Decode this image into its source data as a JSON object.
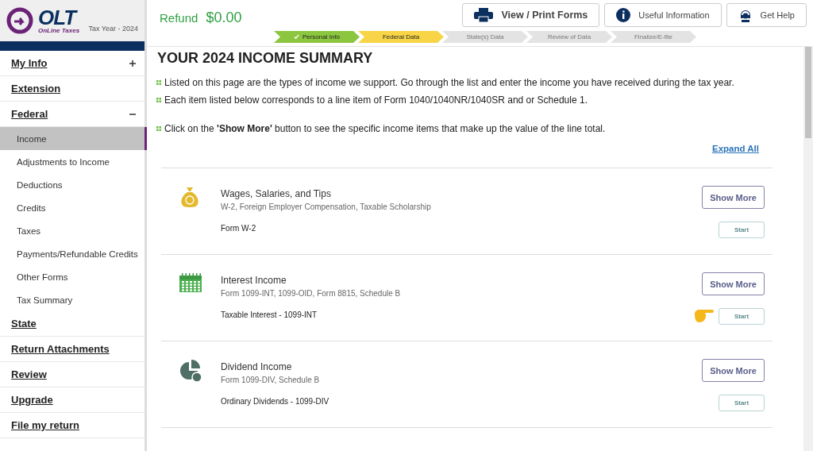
{
  "brand": {
    "name": "OLT",
    "tagline": "OnLine Taxes",
    "tax_year": "Tax Year - 2024"
  },
  "sidebar": {
    "items": [
      {
        "label": "My Info",
        "expanded": false
      },
      {
        "label": "Extension"
      },
      {
        "label": "Federal",
        "expanded": true,
        "children": [
          {
            "label": "Income",
            "selected": true
          },
          {
            "label": "Adjustments to Income",
            "selected": false
          },
          {
            "label": "Deductions",
            "selected": false
          },
          {
            "label": "Credits",
            "selected": false
          },
          {
            "label": "Taxes",
            "selected": false
          },
          {
            "label": "Payments/Refundable Credits",
            "selected": false
          },
          {
            "label": "Other Forms",
            "selected": false
          },
          {
            "label": "Tax Summary",
            "selected": false
          }
        ]
      },
      {
        "label": "State"
      },
      {
        "label": "Return Attachments"
      },
      {
        "label": "Review"
      },
      {
        "label": "Upgrade"
      },
      {
        "label": "File my return"
      }
    ]
  },
  "refund": {
    "label": "Refund",
    "amount": "$0.00"
  },
  "header_buttons": [
    {
      "kind": "print",
      "label": "View / Print Forms"
    },
    {
      "kind": "info",
      "label": "Useful Information"
    },
    {
      "kind": "help",
      "label": "Get Help"
    }
  ],
  "steps": [
    {
      "label": "Personal Info",
      "completed": true,
      "current": false
    },
    {
      "label": "Federal Data",
      "completed": false,
      "current": true
    },
    {
      "label": "State(s) Data",
      "completed": false,
      "current": false
    },
    {
      "label": "Review of Data",
      "completed": false,
      "current": false
    },
    {
      "label": "Finalize/E-file",
      "completed": false,
      "current": false
    }
  ],
  "page_title": "YOUR 2024 INCOME SUMMARY",
  "notes": [
    "Listed on this page are the types of income we support. Go through the list and enter the income you have received during the tax year.",
    "Each item listed below corresponds to a line item of Form 1040/1040NR/1040SR and or Schedule 1.",
    "Click on the **'Show More'** button to see the specific income items that make up the value of the line total."
  ],
  "expand_all": "Expand All",
  "categories": [
    {
      "kind": "wages",
      "title": "Wages, Salaries, and Tips",
      "subtitle": "W-2, Foreign Employer Compensation, Taxable Scholarship",
      "line": "Form W-2",
      "more": "Show More",
      "start": "Start",
      "pointer": false
    },
    {
      "kind": "interest",
      "title": "Interest Income",
      "subtitle": "Form 1099-INT, 1099-OID, Form 8815, Schedule B",
      "line": "Taxable Interest - 1099-INT",
      "more": "Show More",
      "start": "Start",
      "pointer": true
    },
    {
      "kind": "dividend",
      "title": "Dividend Income",
      "subtitle": "Form 1099-DIV, Schedule B",
      "line": "Ordinary Dividends - 1099-DIV",
      "more": "Show More",
      "start": "Start",
      "pointer": false
    }
  ]
}
